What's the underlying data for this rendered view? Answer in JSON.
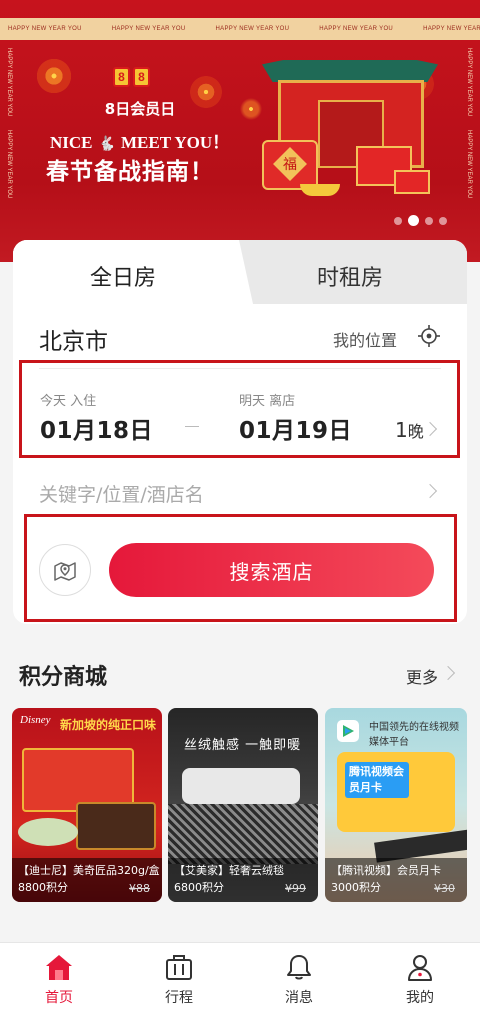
{
  "banner": {
    "ribbon_text": "HAPPY NEW YEAR YOU",
    "logo_text": "8",
    "member_day": "8日会员日",
    "nice_left": "NICE",
    "nice_right": "MEET YOU！",
    "guide": "春节备战指南！",
    "drum_char": "福",
    "slide_count": 4,
    "active_slide": 2
  },
  "booking": {
    "tab_day": "全日房",
    "tab_hour": "时租房",
    "city": "北京市",
    "my_location": "我的位置",
    "checkin_label": "今天 入住",
    "checkin_date": "01月18日",
    "checkout_label": "明天 离店",
    "checkout_date": "01月19日",
    "nights_num": "1",
    "nights_unit": "晚",
    "keyword_placeholder": "关键字/位置/酒店名",
    "search_button": "搜索酒店"
  },
  "mall": {
    "title": "积分商城",
    "more": "更多",
    "products": [
      {
        "brand": "Disney",
        "headline": "新加坡的纯正口味",
        "name": "【迪士尼】美奇匠品320g/盒",
        "points": "8800积分",
        "old_price": "¥88"
      },
      {
        "headline": "丝绒触感  一触即暖",
        "name": "【艾美家】轻奢云绒毯",
        "points": "6800积分",
        "old_price": "¥99"
      },
      {
        "slogan": "中国领先的在线视频媒体平台",
        "card_text": "腾讯视频会员月卡",
        "name": "【腾讯视频】会员月卡",
        "points": "3000积分",
        "old_price": "¥30"
      }
    ]
  },
  "nav": {
    "home": "首页",
    "trip": "行程",
    "message": "消息",
    "mine": "我的"
  },
  "colors": {
    "brand_red": "#e5183a",
    "banner_red": "#c7131d",
    "highlight_border": "#c8141a"
  }
}
